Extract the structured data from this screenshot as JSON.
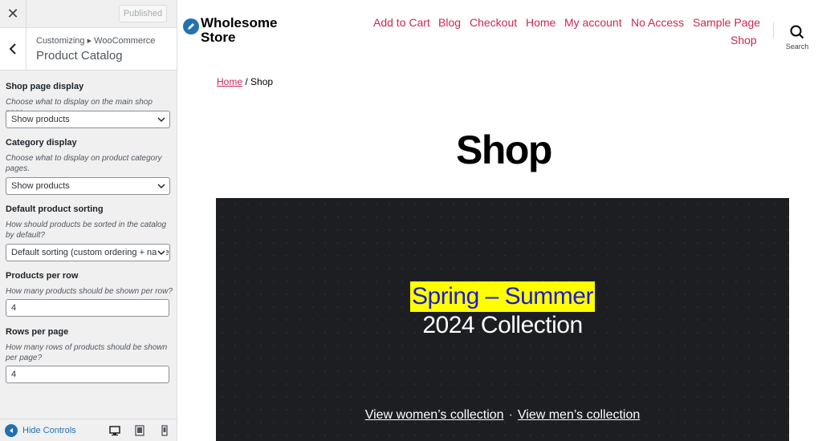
{
  "sidebar": {
    "publish_label": "Published",
    "breadcrumb": "Customizing ▸ WooCommerce",
    "section_title": "Product Catalog",
    "controls": [
      {
        "label": "Shop page display",
        "description": "Choose what to display on the main shop page.",
        "value": "Show products"
      },
      {
        "label": "Category display",
        "description": "Choose what to display on product category pages.",
        "value": "Show products"
      },
      {
        "label": "Default product sorting",
        "description": "How should products be sorted in the catalog by default?",
        "value": "Default sorting (custom ordering + name)"
      },
      {
        "label": "Products per row",
        "description": "How many products should be shown per row?",
        "value": "4"
      },
      {
        "label": "Rows per page",
        "description": "How many rows of products should be shown per page?",
        "value": "4"
      }
    ],
    "footer": {
      "hide_controls_label": "Hide Controls"
    }
  },
  "preview": {
    "site_title": "Wholesome Store",
    "nav": [
      "Add to Cart",
      "Blog",
      "Checkout",
      "Home",
      "My account",
      "No Access",
      "Sample Page",
      "Shop"
    ],
    "search_label": "Search",
    "breadcrumb": {
      "home": "Home",
      "separator": " / ",
      "current": "Shop"
    },
    "page_title": "Shop",
    "hero": {
      "line1": "Spring – Summer",
      "line2": "2024 Collection",
      "link_women": "View women’s collection",
      "separator": "·",
      "link_men": "View men’s collection"
    }
  },
  "colors": {
    "accent": "#cd2653",
    "wp_blue": "#2271b1",
    "hero_bg": "#1d1e21",
    "highlight": "#ffff00",
    "highlight_text": "#1c1ccc"
  }
}
